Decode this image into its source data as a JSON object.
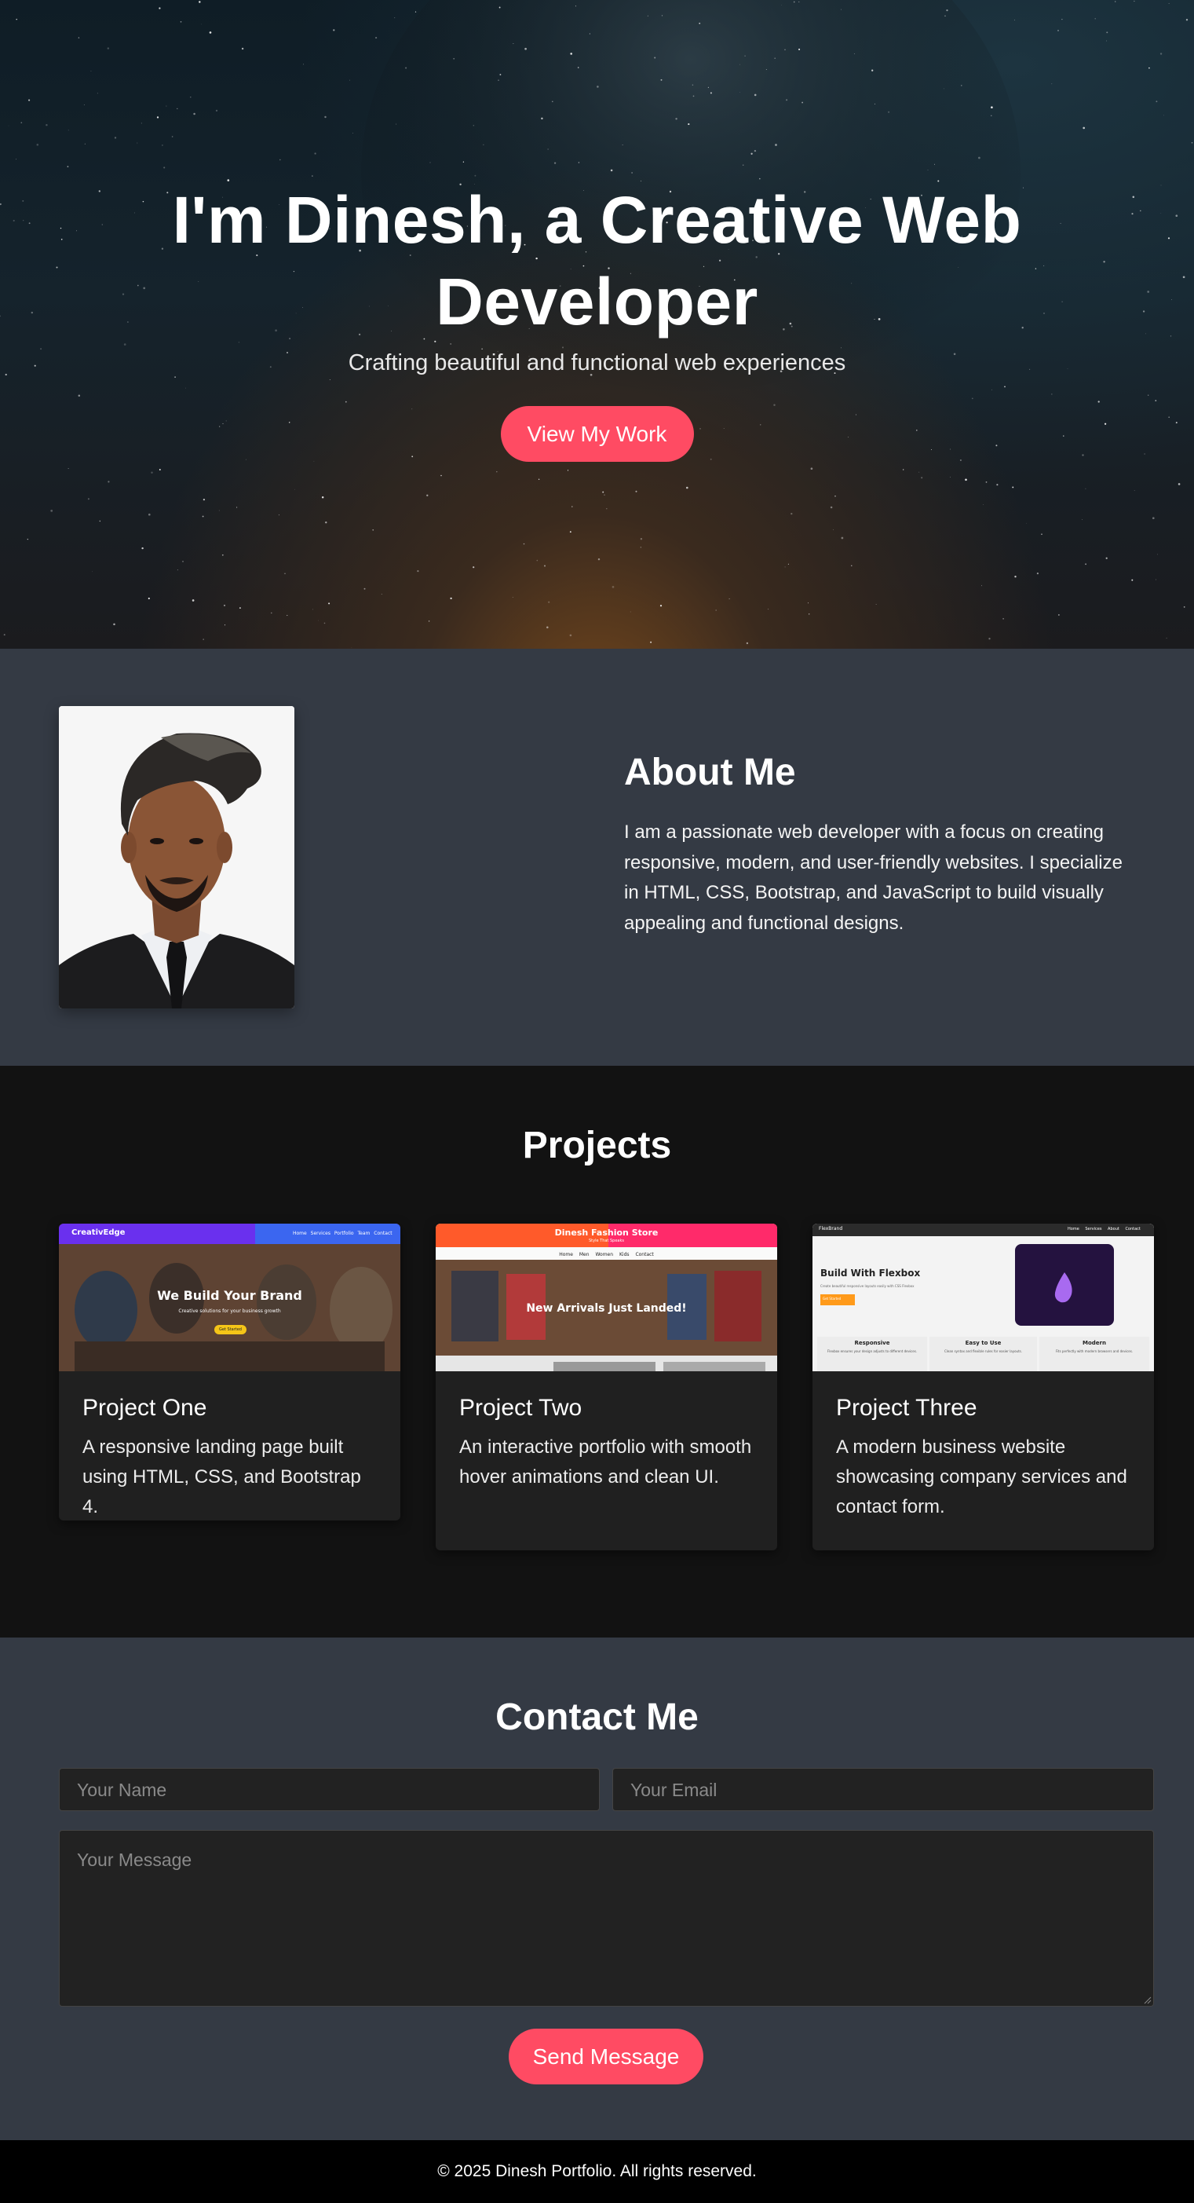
{
  "hero": {
    "title": "I'm Dinesh, a Creative Web Developer",
    "subtitle": "Crafting beautiful and functional web experiences",
    "cta": "View My Work"
  },
  "about": {
    "heading": "About Me",
    "text": "I am a passionate web developer with a focus on creating responsive, modern, and user-friendly websites. I specialize in HTML, CSS, Bootstrap, and JavaScript to build visually appealing and functional designs."
  },
  "projects": {
    "heading": "Projects",
    "items": [
      {
        "title": "Project One",
        "description": "A responsive landing page built using HTML, CSS, and Bootstrap 4.",
        "thumb": {
          "brand": "CreativEdge",
          "nav": [
            "Home",
            "Services",
            "Portfolio",
            "Team",
            "Contact"
          ],
          "headline": "We Build Your Brand",
          "tagline": "Creative solutions for your business growth",
          "button": "Get Started"
        }
      },
      {
        "title": "Project Two",
        "description": "An interactive portfolio with smooth hover animations and clean UI.",
        "thumb": {
          "brand": "Dinesh Fashion Store",
          "tagline": "Style That Speaks",
          "nav": [
            "Home",
            "Men",
            "Women",
            "Kids",
            "Contact"
          ],
          "headline": "New Arrivals Just Landed!"
        }
      },
      {
        "title": "Project Three",
        "description": "A modern business website showcasing company services and contact form.",
        "thumb": {
          "brand": "FlexBrand",
          "nav": [
            "Home",
            "Services",
            "About",
            "Contact"
          ],
          "headline": "Build With Flexbox",
          "tagline": "Create beautiful responsive layouts easily with CSS Flexbox",
          "button": "Get Started",
          "features": [
            {
              "title": "Responsive",
              "text": "Flexbox ensures your design adjusts to different devices."
            },
            {
              "title": "Easy to Use",
              "text": "Clean syntax and flexible rules for easier layouts."
            },
            {
              "title": "Modern",
              "text": "Fits perfectly with modern browsers and devices."
            }
          ]
        }
      }
    ]
  },
  "contact": {
    "heading": "Contact Me",
    "name_placeholder": "Your Name",
    "email_placeholder": "Your Email",
    "message_placeholder": "Your Message",
    "submit": "Send Message"
  },
  "footer": {
    "text": "© 2025 Dinesh Portfolio. All rights reserved."
  },
  "colors": {
    "accent": "#ff4b63",
    "section_alt": "#343a44",
    "section_dark": "#121212",
    "card": "#202020",
    "footer": "#000000"
  }
}
